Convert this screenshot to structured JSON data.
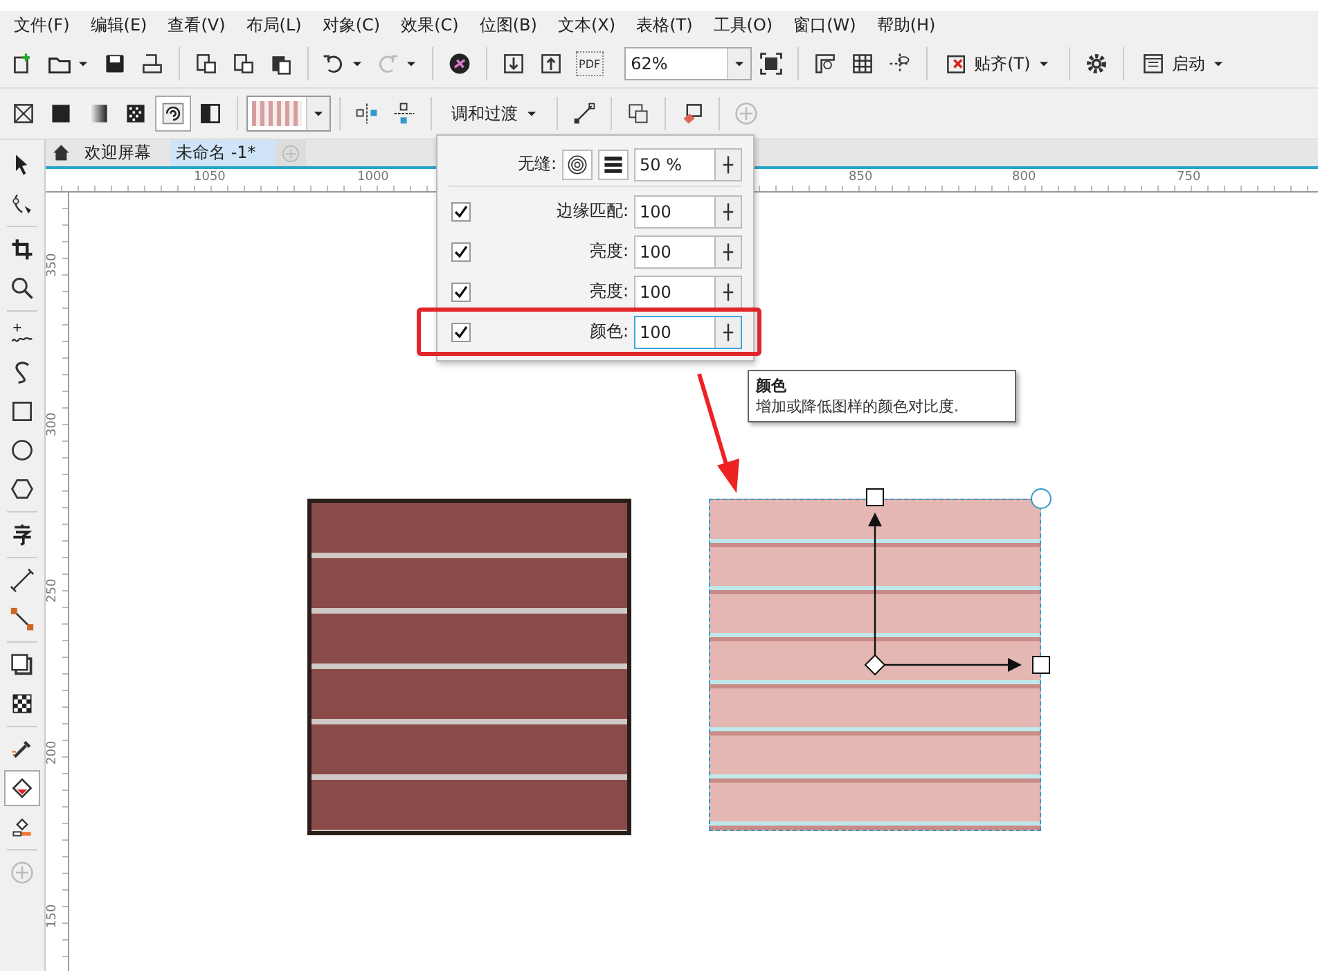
{
  "menu_bar": [
    "文件(F)",
    "编辑(E)",
    "查看(V)",
    "布局(L)",
    "对象(C)",
    "效果(C)",
    "位图(B)",
    "文本(X)",
    "表格(T)",
    "工具(O)",
    "窗口(W)",
    "帮助(H)"
  ],
  "standard_toolbar": {
    "pdf_label": "PDF",
    "zoom": "62%",
    "snap": "贴齐(T)",
    "launch": "启动"
  },
  "property_bar": {
    "blend": "调和过渡"
  },
  "document_tabs": [
    {
      "label": "欢迎屏幕",
      "selected": false
    },
    {
      "label": "未命名 -1*",
      "selected": true
    }
  ],
  "horizontal_ruler": [
    "1050",
    "1000",
    "850",
    "800",
    "750"
  ],
  "vertical_ruler": [
    "350",
    "300",
    "250",
    "200",
    "150"
  ],
  "pattern_popup": {
    "seamless_label": "无缝:",
    "seamless_value": "50 %",
    "rows": [
      {
        "label": "边缘匹配:",
        "value": "100",
        "checked": true,
        "focused": false
      },
      {
        "label": "亮度:",
        "value": "100",
        "checked": true,
        "focused": false
      },
      {
        "label": "亮度:",
        "value": "100",
        "checked": true,
        "focused": false
      },
      {
        "label": "颜色:",
        "value": "100",
        "checked": true,
        "focused": true
      }
    ]
  },
  "tooltip": {
    "title": "颜色",
    "text": "增加或降低图样的颜色对比度."
  }
}
